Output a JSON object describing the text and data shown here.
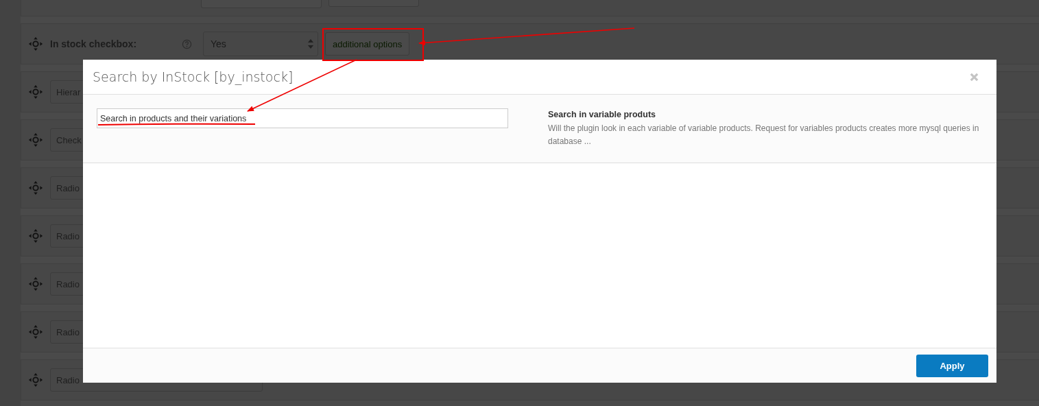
{
  "background_form": {
    "in_stock_row": {
      "label": "In stock checkbox:",
      "select_value": "Yes",
      "button": "additional options"
    },
    "rows": [
      {
        "field_text": "Hierar"
      },
      {
        "field_text": "Check"
      },
      {
        "field_text": "Radio"
      },
      {
        "field_text": "Radio"
      },
      {
        "field_text": "Radio"
      },
      {
        "field_text": "Radio"
      },
      {
        "field_text": "Radio"
      }
    ]
  },
  "modal": {
    "title": "Search by InStock [by_instock]",
    "options": [
      {
        "value": "Search in products and their variations",
        "title": "Search in variable produts",
        "description": "Will the plugin look in each variable of variable products. Request for variables products creates more mysql queries in database ..."
      }
    ],
    "apply_button": "Apply"
  }
}
